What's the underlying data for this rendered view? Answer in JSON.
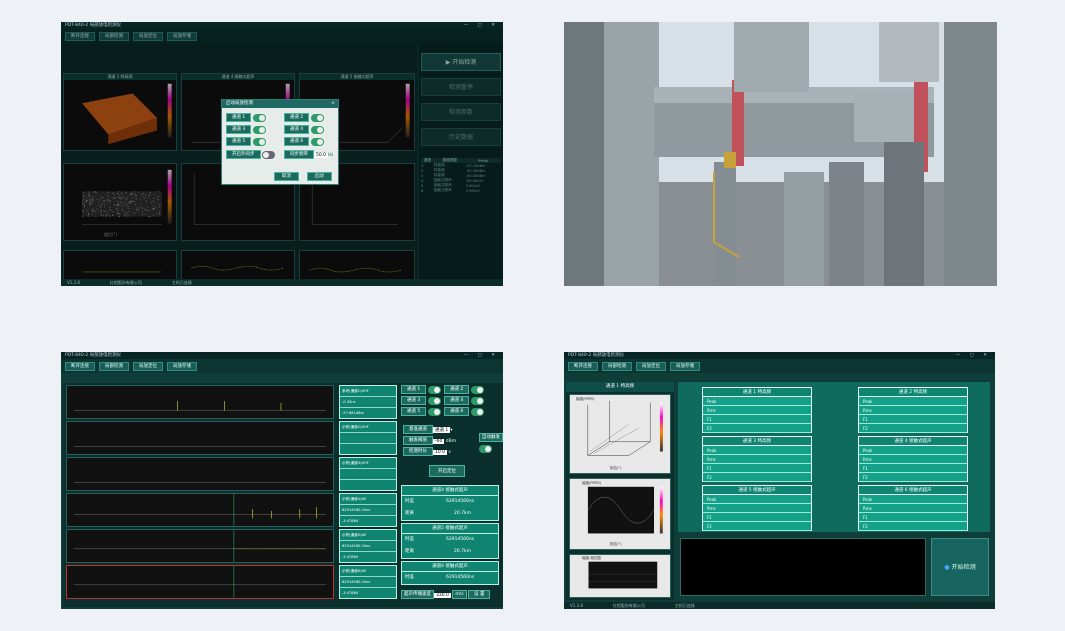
{
  "app": {
    "title": "PDT-840-2 局部放电检测仪",
    "win_controls": "— ▢ ✕",
    "menu": [
      "断开连接",
      "局部检测",
      "局放定位",
      "局放存储"
    ],
    "version": "V1.3.8",
    "company": "红相股份有限公司",
    "status": "主机已连接"
  },
  "p1": {
    "ch_titles": [
      "通道 1 特高频",
      "通道 4 接触式超声",
      "通道 5 接触式超声"
    ],
    "prpd_label": "相位(°)",
    "xticks": [
      "0",
      "90",
      "180",
      "270",
      "360"
    ],
    "side_buttons": [
      "开始检测",
      "检测暂停",
      "检测参数",
      "历史数据"
    ],
    "table_headers": [
      "通道",
      "通道类型",
      "Peak"
    ],
    "table_rows": [
      [
        "1",
        "特高频",
        "-53.10dBm"
      ],
      [
        "2",
        "特高频",
        "-90.00dBm"
      ],
      [
        "3",
        "特高频",
        "-90.00dBm"
      ],
      [
        "4",
        "接触式超声",
        "-90.00mV"
      ],
      [
        "5",
        "接触式超声",
        "2.60mV"
      ],
      [
        "6",
        "接触式超声",
        "2.56mV"
      ]
    ],
    "dialog": {
      "title": "启动局放检测",
      "close": "×",
      "channels": [
        "通道 1",
        "通道 2",
        "通道 3",
        "通道 4",
        "通道 5",
        "通道 6"
      ],
      "sync_label": "开启外同步",
      "freq_label": "同步频率",
      "freq_value": "50.0",
      "freq_unit": "Hz",
      "cancel": "取消",
      "start": "启动"
    }
  },
  "p3": {
    "strip_labels": [
      [
        "参考(通道1)UHF",
        "-0.33ns",
        "-57.861dBm"
      ],
      [
        "示踪(通道2)UHF",
        "",
        ""
      ],
      [
        "示踪(通道3)UHF",
        "",
        ""
      ],
      [
        "示踪(通道4)AE",
        "62914560.00ns",
        "-3.4786V"
      ],
      [
        "示踪(通道5)AE",
        "62914560.00ns",
        "-3.4786V"
      ],
      [
        "示踪(通道6)AE",
        "62914560.00ns",
        "-3.4786V"
      ]
    ],
    "channels": [
      "通道 1",
      "通道 2",
      "通道 3",
      "通道 4",
      "通道 5",
      "通道 6"
    ],
    "ref_label": "基准通道",
    "ref_value": "通道 1",
    "threshold_label": "触发阈值",
    "threshold_value": "-60",
    "threshold_unit": "dBm",
    "span_label": "检测时长",
    "span_value": "10.0",
    "span_unit": "s",
    "auto_label": "自动触发",
    "locate_button": "开启定位",
    "results": [
      {
        "title": "通道4 接触式超声",
        "t_label": "时差",
        "t_value": "62914560ns",
        "d_label": "距离",
        "d_value": "20.7km"
      },
      {
        "title": "通道5 接触式超声",
        "t_label": "时差",
        "t_value": "62914560ns",
        "d_label": "距离",
        "d_value": "20.7km"
      },
      {
        "title": "通道6 接触式超声",
        "t_label": "时差",
        "t_value": "62914560ns"
      }
    ],
    "speed_label": "超声传播速度",
    "speed_value": "330.0",
    "speed_unit": "m/s",
    "set_button": "设 置"
  },
  "p4": {
    "left_title": "通道 1 特高频",
    "plot1_label": "幅值(PRPS)",
    "plot2_label": "幅值(PRPD)",
    "plot3_label": "幅值-相位图",
    "phase_label": "相位(°)",
    "cards": [
      {
        "title": "通道 1 特高频"
      },
      {
        "title": "通道 2 特高频"
      },
      {
        "title": "通道 3 特高频"
      },
      {
        "title": "通道 4 接触式超声"
      },
      {
        "title": "通道 5 接触式超声"
      },
      {
        "title": "通道 6 接触式超声"
      }
    ],
    "row_labels": [
      "Peak",
      "Rms",
      "F1",
      "F2"
    ],
    "start_button": "开始检测"
  }
}
